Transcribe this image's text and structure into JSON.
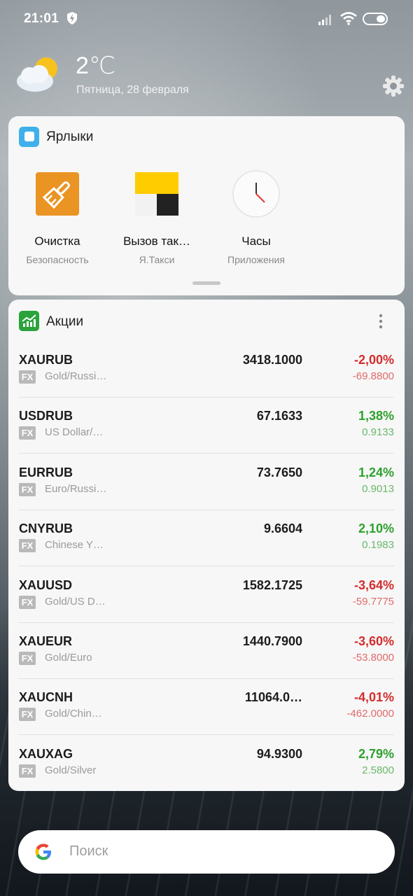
{
  "status_bar": {
    "time": "21:01"
  },
  "weather": {
    "temperature": "2℃",
    "date": "Пятница, 28 февраля"
  },
  "shortcuts": {
    "title": "Ярлыки",
    "apps": [
      {
        "name": "Очистка",
        "subtitle": "Безопасность",
        "icon": "broom-icon"
      },
      {
        "name": "Вызов так…",
        "subtitle": "Я.Такси",
        "icon": "yandex-taxi-icon"
      },
      {
        "name": "Часы",
        "subtitle": "Приложения",
        "icon": "clock-icon"
      }
    ]
  },
  "stocks": {
    "title": "Акции",
    "badge": "FX",
    "items": [
      {
        "symbol": "XAURUB",
        "desc": "Gold/Russi…",
        "price": "3418.1000",
        "pct": "-2,00%",
        "change": "-69.8800",
        "trend": "down"
      },
      {
        "symbol": "USDRUB",
        "desc": "US Dollar/…",
        "price": "67.1633",
        "pct": "1,38%",
        "change": "0.9133",
        "trend": "up"
      },
      {
        "symbol": "EURRUB",
        "desc": "Euro/Russi…",
        "price": "73.7650",
        "pct": "1,24%",
        "change": "0.9013",
        "trend": "up"
      },
      {
        "symbol": "CNYRUB",
        "desc": "Chinese Y…",
        "price": "9.6604",
        "pct": "2,10%",
        "change": "0.1983",
        "trend": "up"
      },
      {
        "symbol": "XAUUSD",
        "desc": "Gold/US D…",
        "price": "1582.1725",
        "pct": "-3,64%",
        "change": "-59.7775",
        "trend": "down"
      },
      {
        "symbol": "XAUEUR",
        "desc": "Gold/Euro",
        "price": "1440.7900",
        "pct": "-3,60%",
        "change": "-53.8000",
        "trend": "down"
      },
      {
        "symbol": "XAUCNH",
        "desc": "Gold/Chin…",
        "price": "11064.0…",
        "pct": "-4,01%",
        "change": "-462.0000",
        "trend": "down"
      },
      {
        "symbol": "XAUXAG",
        "desc": "Gold/Silver",
        "price": "94.9300",
        "pct": "2,79%",
        "change": "2.5800",
        "trend": "up"
      }
    ]
  },
  "search": {
    "placeholder": "Поиск"
  },
  "colors": {
    "up": "#2ea02e",
    "down": "#d52c2c"
  }
}
